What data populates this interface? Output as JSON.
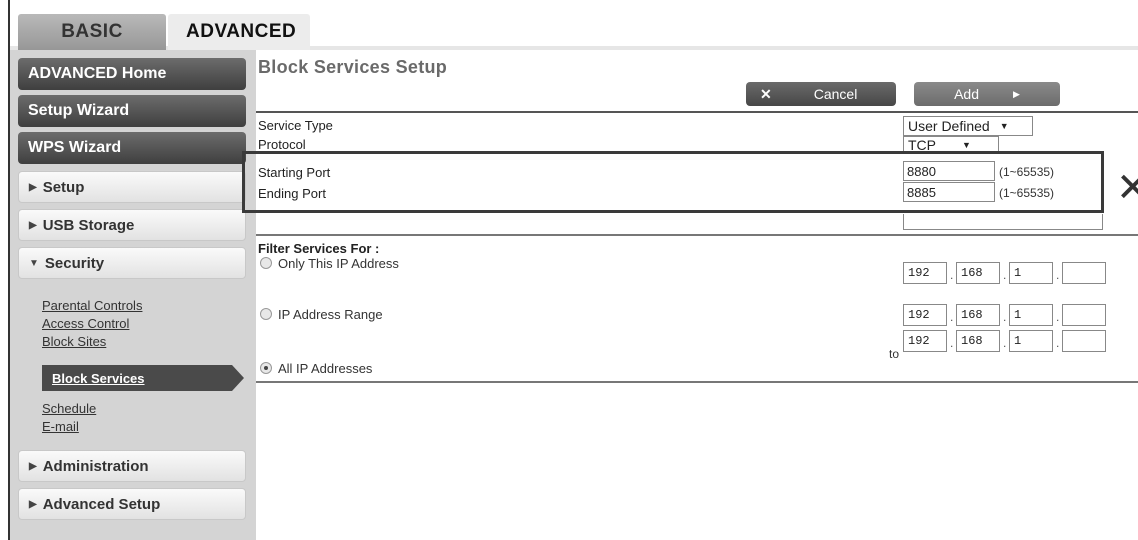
{
  "tabs": {
    "basic": "BASIC",
    "advanced": "ADVANCED"
  },
  "sidebar": {
    "advanced_home": "ADVANCED Home",
    "setup_wizard": "Setup Wizard",
    "wps_wizard": "WPS Wizard",
    "setup": "Setup",
    "usb_storage": "USB Storage",
    "security": "Security",
    "security_links": {
      "parental_controls": "Parental Controls",
      "access_control": "Access Control",
      "block_sites": "Block Sites",
      "block_services": "Block Services",
      "schedule": "Schedule",
      "email": "E-mail"
    },
    "administration": "Administration",
    "advanced_setup": "Advanced Setup"
  },
  "main": {
    "title": "Block Services Setup",
    "cancel_label": "Cancel",
    "add_label": "Add",
    "service_type_label": "Service Type",
    "service_type_value": "User Defined",
    "protocol_label": "Protocol",
    "protocol_value": "TCP",
    "starting_port_label": "Starting Port",
    "starting_port_value": "8880",
    "ending_port_label": "Ending Port",
    "ending_port_value": "8885",
    "port_range_hint": "(1~65535)",
    "filter_label": "Filter Services For :",
    "only_ip_label": "Only This IP Address",
    "ip_range_label": "IP Address Range",
    "all_ip_label": "All IP Addresses",
    "to_label": "to",
    "only_ip": [
      "192",
      "168",
      "1",
      ""
    ],
    "range_start": [
      "192",
      "168",
      "1",
      ""
    ],
    "range_end": [
      "192",
      "168",
      "1",
      ""
    ],
    "selected_filter": "All IP Addresses"
  },
  "icons": {
    "cancel": "x-icon",
    "add": "play-icon",
    "close": "close-icon",
    "expand": "triangle-right-icon",
    "collapse": "triangle-down-icon"
  }
}
